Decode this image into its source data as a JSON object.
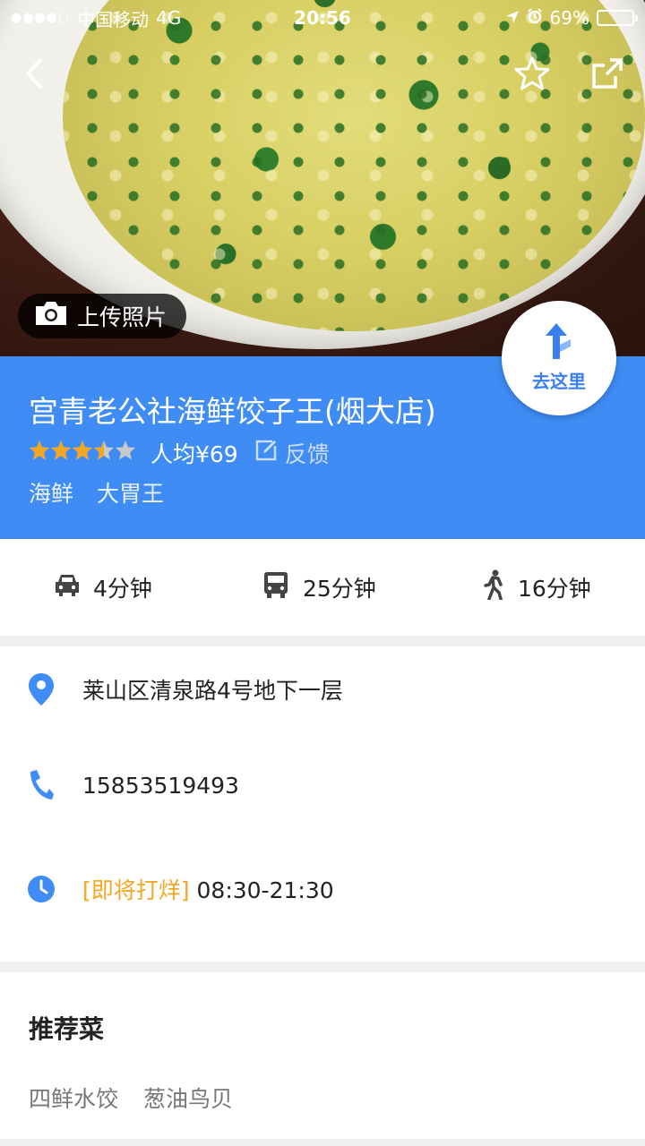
{
  "status_bar": {
    "signal_dots": "●●●●○",
    "carrier": "中国移动",
    "network": "4G",
    "time": "20:56",
    "battery_percent": "69%",
    "battery_level": 0.69
  },
  "header": {
    "back_icon": "chevron-left-icon",
    "favorite_icon": "star-outline-icon",
    "share_icon": "share-icon",
    "upload_label": "上传照片"
  },
  "place": {
    "name": "宫青老公社海鲜饺子王(烟大店)",
    "rating": 3.5,
    "rating_max": 5,
    "avg_price": "人均¥69",
    "feedback_label": "反馈",
    "tags": [
      "海鲜",
      "大胃王"
    ],
    "goto_label": "去这里"
  },
  "transport": [
    {
      "icon": "car-icon",
      "label": "4分钟"
    },
    {
      "icon": "bus-icon",
      "label": "25分钟"
    },
    {
      "icon": "walk-icon",
      "label": "16分钟"
    }
  ],
  "details": {
    "address": "莱山区清泉路4号地下一层",
    "phone": "15853519493",
    "hours_status": "[即将打烊]",
    "hours": "08:30-21:30"
  },
  "recommended": {
    "title": "推荐菜",
    "items": [
      "四鲜水饺",
      "葱油鸟贝"
    ]
  },
  "colors": {
    "accent_blue": "#3f8cf5",
    "star": "#f5a623",
    "closing_soon": "#f5a623"
  }
}
